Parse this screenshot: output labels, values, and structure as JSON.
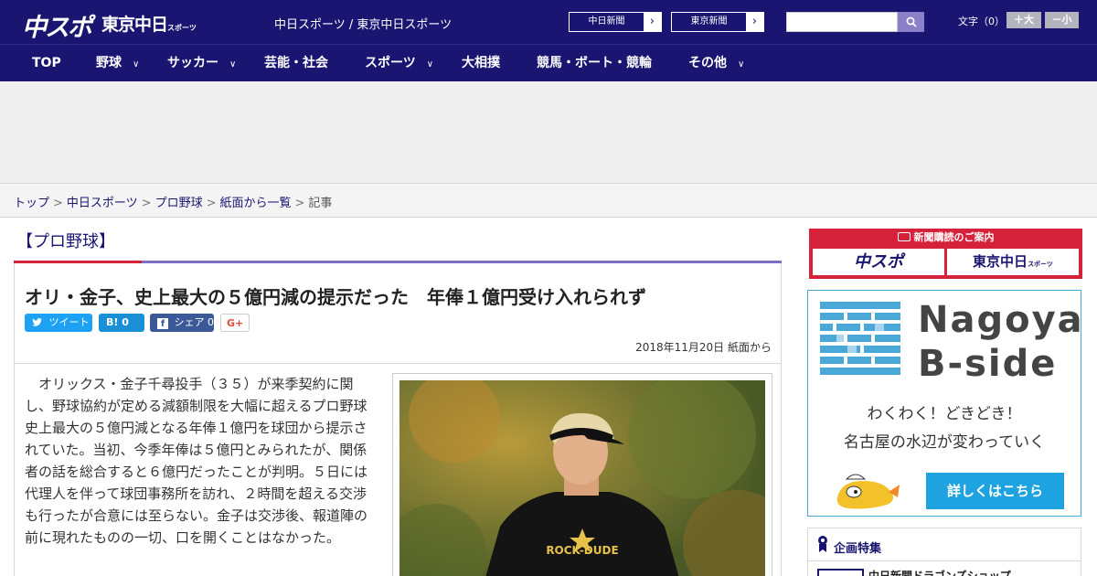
{
  "header": {
    "logo_main": "中スポ",
    "logo_tokyo": "東京中日",
    "logo_tokyo_sub": "スポーツ",
    "site_names": "中日スポーツ / 東京中日スポーツ",
    "links": [
      {
        "label": "中日新聞"
      },
      {
        "label": "東京新聞"
      }
    ],
    "search_placeholder": "",
    "fontsize_label": "文字（0）",
    "font_larger": "＋大",
    "font_smaller": "－小"
  },
  "nav": {
    "items": [
      {
        "label": "TOP",
        "has_menu": false
      },
      {
        "label": "野球",
        "has_menu": true
      },
      {
        "label": "サッカー",
        "has_menu": true
      },
      {
        "label": "芸能・社会",
        "has_menu": false
      },
      {
        "label": "スポーツ",
        "has_menu": true
      },
      {
        "label": "大相撲",
        "has_menu": false
      },
      {
        "label": "競馬・ボート・競輪",
        "has_menu": false
      },
      {
        "label": "その他",
        "has_menu": true
      }
    ]
  },
  "breadcrumb": {
    "items": [
      "トップ",
      "中日スポーツ",
      "プロ野球",
      "紙面から一覧"
    ],
    "current": "記事"
  },
  "article": {
    "category": "【プロ野球】",
    "title": "オリ・金子、史上最大の５億円減の提示だった　年俸１億円受け入れられず",
    "share": {
      "tweet": "ツイート",
      "hatena": "B! 0",
      "facebook": "シェア 0",
      "gplus": "G+"
    },
    "date": "2018年11月20日 紙面から",
    "body": "オリックス・金子千尋投手（３５）が来季契約に関し、野球協約が定める減額制限を大幅に超えるプロ野球史上最大の５億円減となる年俸１億円を球団から提示されていた。当初、今季年俸は５億円とみられたが、関係者の話を総合すると６億円だったことが判明。５日には代理人を伴って球団事務所を訪れ、２時間を超える交渉も行ったが合意には至らない。金子は交渉後、報道陣の前に現れたものの一切、口を開くことはなかった。",
    "photo_shirt_text": "ROCK-DUDE"
  },
  "sidebar": {
    "subscribe_title": "新聞購読のご案内",
    "subscribe_a": "中スポ",
    "subscribe_b": "東京中日",
    "subscribe_b_sub": "スポーツ",
    "bside_title_1": "Nagoya",
    "bside_title_2": "B-side",
    "bside_copy_1": "わくわく！どきどき！",
    "bside_copy_2": "名古屋の水辺が変わっていく",
    "bside_button": "詳しくはこちら",
    "feature_title": "企画特集",
    "feature_item": "中日新聞ドラゴンズショップ"
  },
  "colors": {
    "brand_navy": "#1a1570",
    "accent_red": "#d6213a",
    "accent_purple": "#7a70c8",
    "bside_blue": "#1ea3e0"
  }
}
